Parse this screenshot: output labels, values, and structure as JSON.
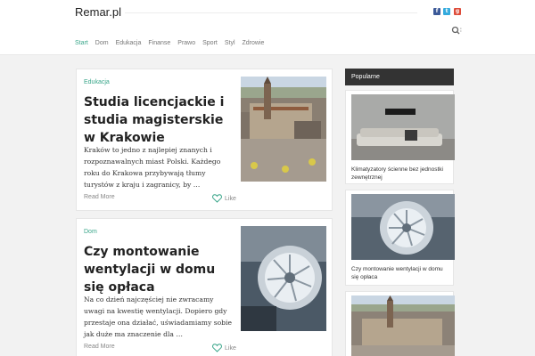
{
  "site": {
    "logo": "Remar.pl"
  },
  "social": [
    "f",
    "t",
    "g"
  ],
  "nav": {
    "items": [
      "Start",
      "Dom",
      "Edukacja",
      "Finanse",
      "Prawo",
      "Sport",
      "Styl",
      "Zdrowie"
    ]
  },
  "posts": [
    {
      "category": "Edukacja",
      "title": "Studia licencjackie i studia magisterskie w Krakowie",
      "excerpt": "Kraków to jedno z najlepiej znanych i rozpoznawalnych miast Polski. Każdego roku do Krakowa przybywają tłumy turystów z kraju i zagranicy, by …",
      "read_more": "Read More",
      "like": "Like"
    },
    {
      "category": "Dom",
      "title": "Czy montowanie wentylacji w domu się opłaca",
      "excerpt": "Na co dzień najczęściej nie zwracamy uwagi na kwestię wentylacji. Dopiero gdy przestaje ona działać, uświadamiamy sobie jak duże ma znaczenie dla …",
      "read_more": "Read More",
      "like": "Like"
    }
  ],
  "sidebar": {
    "title": "Popularne",
    "items": [
      {
        "caption": "Klimatyzatory ścienne bez jednostki zewnętrznej"
      },
      {
        "caption": "Czy montowanie wentylacji w domu się opłaca"
      },
      {
        "caption": ""
      }
    ]
  },
  "colors": {
    "accent": "#3aa68a",
    "sidebar_header": "#333333"
  }
}
